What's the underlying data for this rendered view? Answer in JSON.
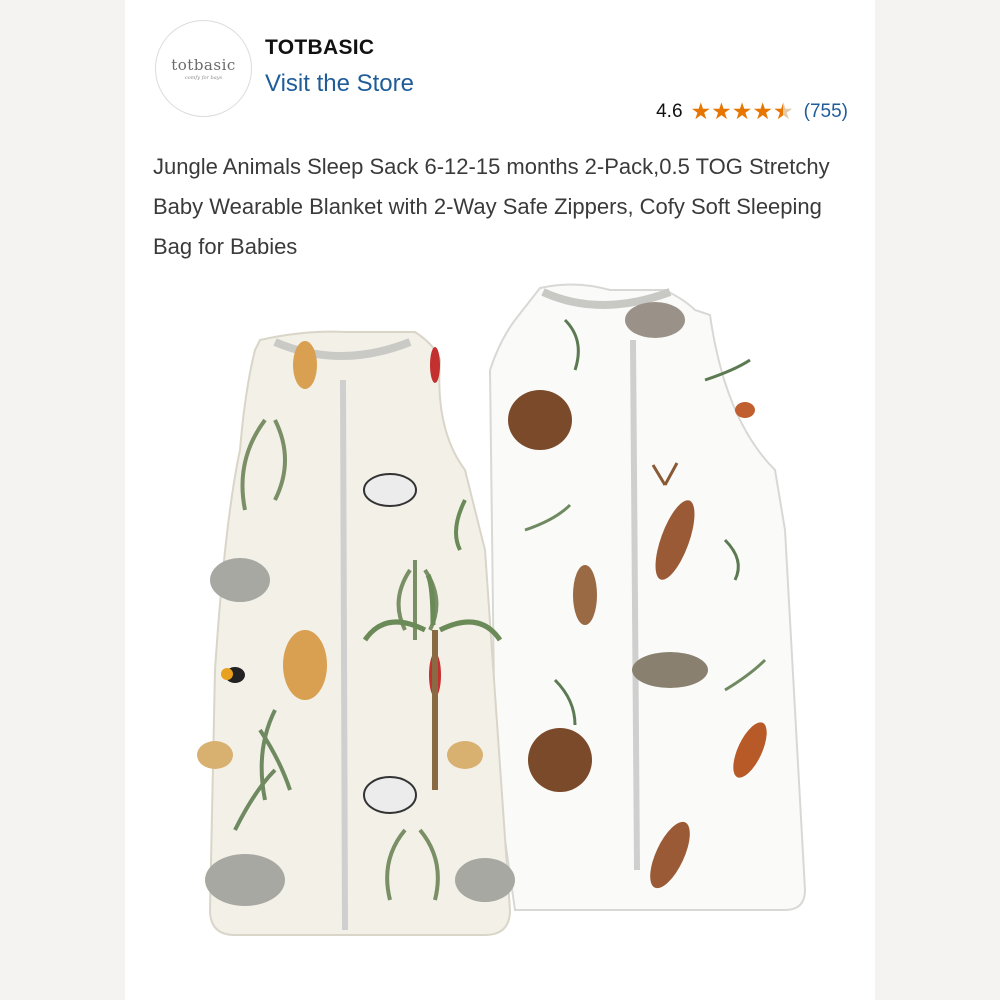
{
  "store": {
    "logo_text": "totbasic",
    "logo_tagline": "comfy for bays",
    "brand_name": "TOTBASIC",
    "visit_link": "Visit the Store"
  },
  "rating": {
    "value": "4.6",
    "stars": 4.6,
    "count": "(755)",
    "star_color": "#e77600"
  },
  "product": {
    "title": "Jungle Animals Sleep Sack 6-12-15 months 2-Pack,0.5 TOG Stretchy Baby Wearable Blanket with 2-Way Safe Zippers, Cofy Soft Sleeping Bag for Babies",
    "image_semantic": "two-sleep-sacks-jungle-and-woodland-print"
  },
  "colors": {
    "link": "#1f5c99",
    "title_text": "#3a3a3a"
  }
}
